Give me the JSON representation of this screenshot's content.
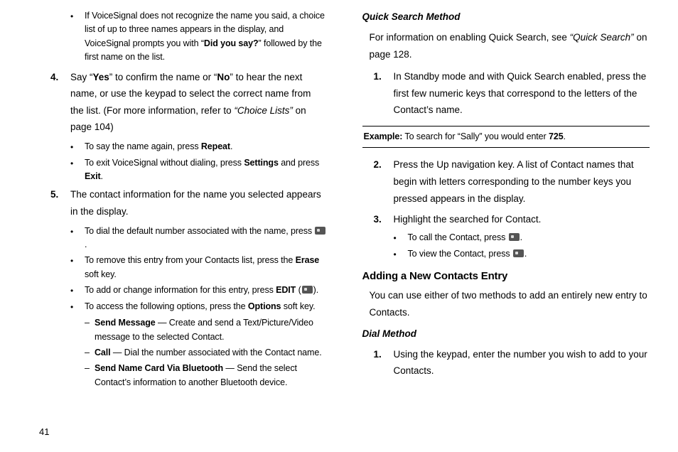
{
  "left": {
    "bullet_voicesignal": "If VoiceSignal does not recognize the name you said, a choice list of up to three names appears in the display, and VoiceSignal prompts you with “",
    "did_you_say": "Did you say?",
    "bullet_voicesignal_suffix": "” followed by the first name on the list.",
    "step4_num": "4.",
    "step4_p1": "Say “",
    "step4_yes": "Yes",
    "step4_p2": "” to confirm the name or “",
    "step4_no": "No",
    "step4_p3": "” to hear the next name, or use the keypad to select the correct name from the list. (For more information, refer to ",
    "step4_choice": "“Choice Lists”",
    "step4_p4": "  on page 104)",
    "sub_repeat_pre": "To say the name again, press ",
    "sub_repeat": "Repeat",
    "sub_repeat_suf": ".",
    "sub_exit_pre": "To exit VoiceSignal without dialing, press ",
    "sub_settings": "Settings",
    "sub_exit_mid": " and press ",
    "sub_exit": "Exit",
    "sub_exit_suf": ".",
    "step5_num": "5.",
    "step5_text": "The contact information for the name you selected appears in the display.",
    "dial_default_pre": "To dial the default number associated with the name, press ",
    "dial_default_suf": ".",
    "remove_pre": "To remove this entry from your Contacts list, press the ",
    "remove_erase": "Erase",
    "remove_suf": " soft key.",
    "addchange_pre": "To add or change information for this entry, press ",
    "addchange_edit": "EDIT",
    "addchange_mid": " (",
    "addchange_suf": ").",
    "access_pre": "To access the following options, press the ",
    "access_options": "Options",
    "access_suf": " soft key.",
    "d_sendmsg_label": "Send Message",
    "d_sendmsg_text": " — Create and send a Text/Picture/Video message to the selected Contact.",
    "d_call_label": "Call",
    "d_call_text": " — Dial the number associated with the Contact name.",
    "d_namecard_label": "Send Name Card Via Bluetooth",
    "d_namecard_text": " — Send the select Contact’s information to another Bluetooth device."
  },
  "right": {
    "h_qsm": "Quick Search Method",
    "intro_pre": "For information on enabling Quick Search, see ",
    "intro_ref": "“Quick Search”",
    "intro_suf": " on page 128.",
    "step1_num": "1.",
    "step1_text": "In Standby mode and with Quick Search enabled, press the first few numeric keys that correspond to the letters of the Contact’s name.",
    "example_label": "Example:",
    "example_text": " To search for “Sally” you would enter ",
    "example_num": "725",
    "example_suf": ".",
    "step2_num": "2.",
    "step2_text": "Press the Up navigation key. A list of Contact names that begin with letters corresponding to the number keys you pressed appears in the display.",
    "step3_num": "3.",
    "step3_text": "Highlight the searched for Contact.",
    "call_contact_pre": "To call the Contact, press ",
    "call_contact_suf": ".",
    "view_contact_pre": "To view the Contact, press ",
    "view_contact_suf": ".",
    "h_add": "Adding a New Contacts Entry",
    "add_intro": "You can use either of two methods to add an entirely new entry to Contacts.",
    "h_dial": "Dial Method",
    "dial_step1_num": "1.",
    "dial_step1_text": "Using the keypad, enter the number you wish to add to your Contacts."
  },
  "page_number": "41"
}
